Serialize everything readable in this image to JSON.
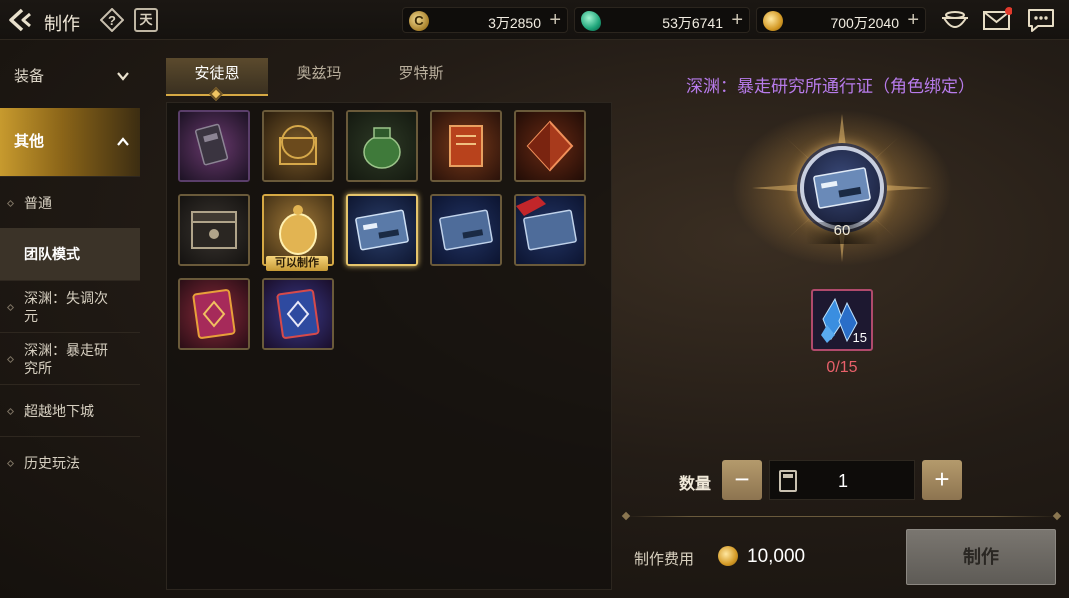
{
  "header": {
    "title": "制作",
    "calendar_char": "天",
    "currencies": [
      {
        "icon": "gold-c-coin-icon",
        "value": "3万2850"
      },
      {
        "icon": "green-crystal-icon",
        "value": "53万6741"
      },
      {
        "icon": "gold-coin-icon",
        "value": "700万2040"
      }
    ]
  },
  "sidebar": {
    "cat_equip": "装备",
    "cat_other": "其他",
    "items": [
      {
        "label": "普通"
      },
      {
        "label": "团队模式"
      },
      {
        "label": "深渊：失调次元"
      },
      {
        "label": "深渊：暴走研究所"
      },
      {
        "label": "超越地下城"
      },
      {
        "label": "历史玩法"
      }
    ]
  },
  "tabs": [
    {
      "label": "安徒恩"
    },
    {
      "label": "奥兹玛"
    },
    {
      "label": "罗特斯"
    }
  ],
  "grid": {
    "craftable_tag": "可以制作"
  },
  "detail": {
    "title": "深渊：暴走研究所通行证（角色绑定）",
    "item_count": "60",
    "material_qty": "15",
    "material_progress": "0/15",
    "quantity_label": "数量",
    "quantity_value": "1",
    "cost_label": "制作费用",
    "cost_value": "10,000",
    "make_button": "制作"
  }
}
